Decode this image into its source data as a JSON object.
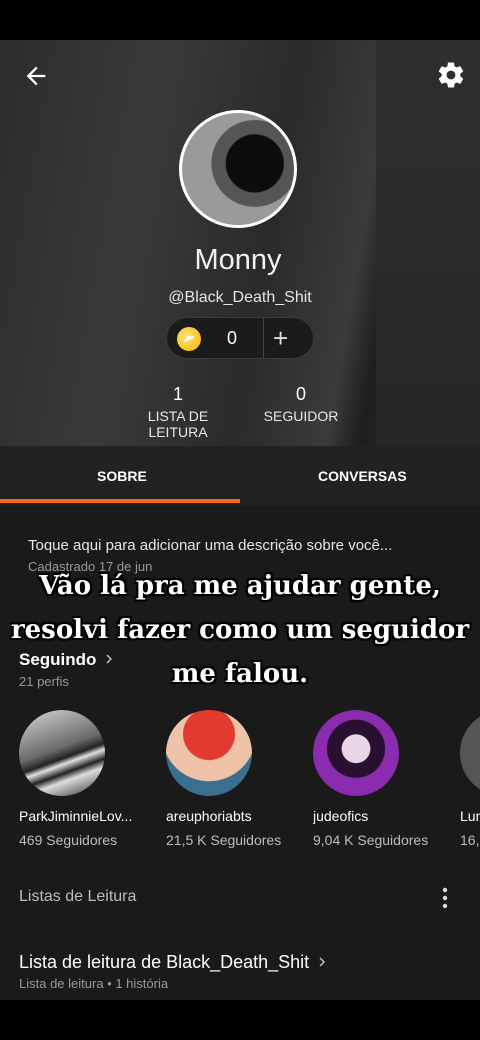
{
  "header": {
    "display_name": "Monny",
    "handle": "@Black_Death_Shit",
    "coins": "0",
    "add_label": "+"
  },
  "stats": [
    {
      "value": "1",
      "label": "LISTA DE LEITURA"
    },
    {
      "value": "0",
      "label": "SEGUIDOR"
    }
  ],
  "tabs": [
    {
      "label": "SOBRE",
      "active": true
    },
    {
      "label": "CONVERSAS",
      "active": false
    }
  ],
  "about": {
    "description_placeholder": "Toque aqui para adicionar uma descrição sobre você...",
    "since": "Cadastrado 17 de jun"
  },
  "overlay_caption": [
    "Vão lá pra me ajudar gente,",
    "resolvi fazer como um seguidor",
    "me falou."
  ],
  "following": {
    "title": "Seguindo",
    "count": "21 perfis",
    "users": [
      {
        "name": "ParkJiminnieLov...",
        "followers": "469 Seguidores"
      },
      {
        "name": "areuphoriabts",
        "followers": "21,5 K Seguidores"
      },
      {
        "name": "judeofics",
        "followers": "9,04 K Seguidores"
      },
      {
        "name": "Lun",
        "followers": "16,"
      }
    ]
  },
  "reading_lists": {
    "section_title": "Listas de Leitura",
    "item_title": "Lista de leitura de Black_Death_Shit",
    "item_meta": "Lista de leitura • 1 história"
  },
  "colors": {
    "accent": "#f26b1d",
    "background": "#1a1a1a",
    "coin": "#f4b400"
  },
  "icons": [
    "back-arrow-icon",
    "gear-icon",
    "coin-icon",
    "plus-icon",
    "chevron-right-icon",
    "kebab-menu-icon"
  ]
}
